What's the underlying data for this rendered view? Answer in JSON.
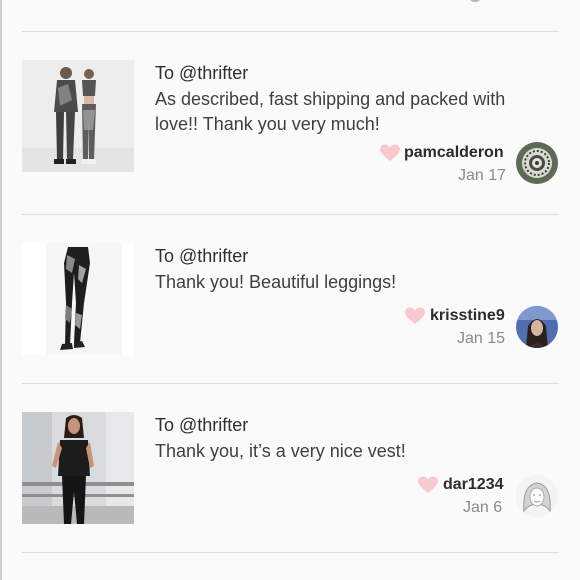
{
  "reviews": [
    {
      "to": "To @thrifter",
      "message": "As described, fast shipping and packed with love!! Thank you very much!",
      "username": "pamcalderon",
      "date": "Jan 17",
      "thumbnail": "couple-activewear-photo",
      "avatar": "mandala-avatar"
    },
    {
      "to": "To @thrifter",
      "message": "Thank you! Beautiful leggings!",
      "username": "krisstine9",
      "date": "Jan 15",
      "thumbnail": "leggings-photo",
      "avatar": "woman-portrait-avatar"
    },
    {
      "to": "To @thrifter",
      "message": "Thank you, it’s a very nice vest!",
      "username": "dar1234",
      "date": "Jan 6",
      "thumbnail": "vest-photo",
      "avatar": "sketch-portrait-avatar"
    }
  ],
  "colors": {
    "heart": "#f7c9cf",
    "divider": "#dedcdd",
    "background": "#fbfafb",
    "date_text": "#8a8a8a"
  },
  "icons": [
    "heart-icon"
  ]
}
